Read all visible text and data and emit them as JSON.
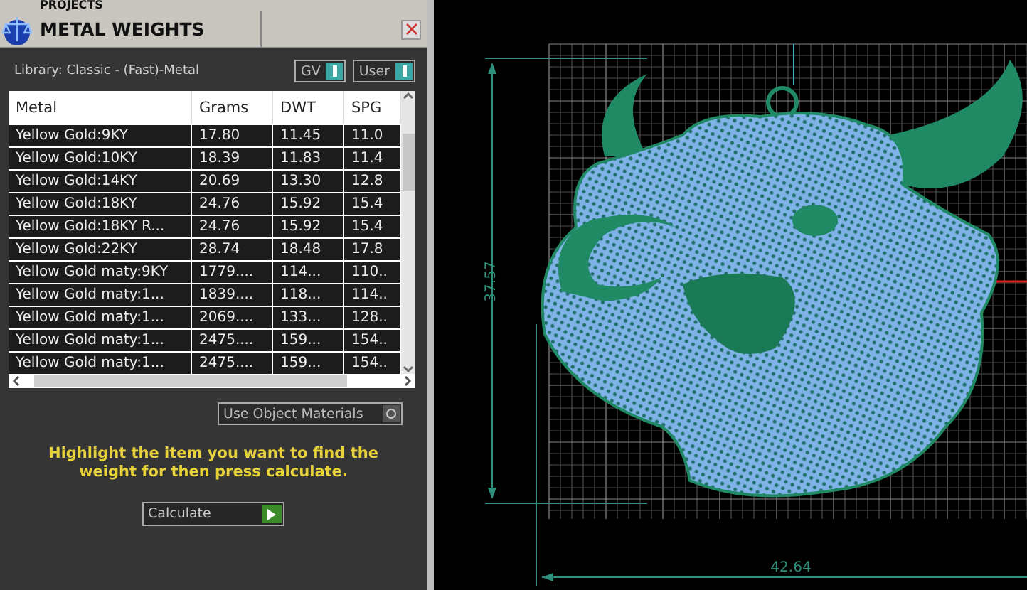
{
  "projects_bar": {
    "title": "PROJECTS"
  },
  "panel": {
    "title": "METAL WEIGHTS"
  },
  "library": {
    "label": "Library: Classic - (Fast)-Metal",
    "toggles": [
      {
        "label": "GV",
        "on": true
      },
      {
        "label": "User",
        "on": true
      }
    ]
  },
  "table": {
    "columns": [
      "Metal",
      "Grams",
      "DWT",
      "SPG"
    ],
    "rows": [
      [
        "Yellow Gold:9KY",
        "17.80",
        "11.45",
        "11.0"
      ],
      [
        "Yellow Gold:10KY",
        "18.39",
        "11.83",
        "11.4"
      ],
      [
        "Yellow Gold:14KY",
        "20.69",
        "13.30",
        "12.8"
      ],
      [
        "Yellow Gold:18KY",
        "24.76",
        "15.92",
        "15.4"
      ],
      [
        "Yellow Gold:18KY R...",
        "24.76",
        "15.92",
        "15.4"
      ],
      [
        "Yellow Gold:22KY",
        "28.74",
        "18.48",
        "17.8"
      ],
      [
        "Yellow Gold maty:9KY",
        "1779....",
        "114...",
        "110.."
      ],
      [
        "Yellow Gold maty:1...",
        "1839....",
        "118...",
        "114.."
      ],
      [
        "Yellow Gold maty:1...",
        "2069....",
        "133...",
        "128.."
      ],
      [
        "Yellow Gold maty:1...",
        "2475....",
        "159...",
        "154.."
      ],
      [
        "Yellow Gold maty:1...",
        "2475....",
        "159...",
        "154.."
      ]
    ]
  },
  "use_object_materials": {
    "label": "Use Object Materials",
    "on": false
  },
  "instruction": "Highlight the item you want to find the weight for then press calculate.",
  "calculate_button": "Calculate",
  "viewport": {
    "height_dimension": "37.57",
    "width_dimension": "42.64"
  }
}
